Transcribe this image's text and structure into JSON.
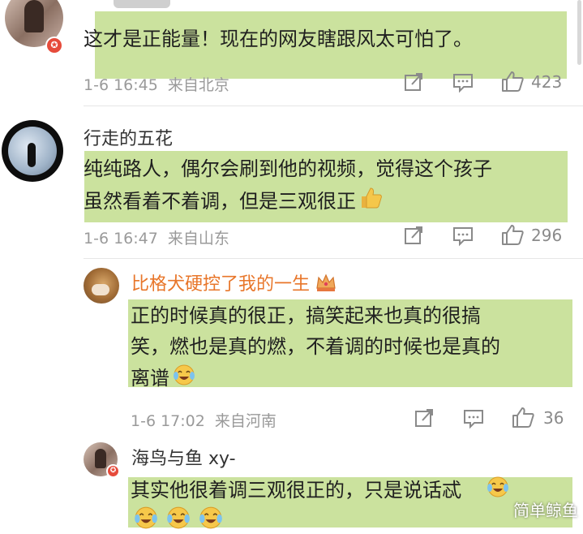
{
  "comments": [
    {
      "username": "",
      "text_lines": [
        "这才是正能量！现在的网友瞎跟风太可怕了。"
      ],
      "time": "1-6 16:45",
      "location": "来自北京",
      "likes": "423"
    },
    {
      "username": "行走的五花",
      "text_lines": [
        "纯纯路人，偶尔会刷到他的视频，觉得这个孩子",
        "虽然看着不着调，但是三观很正"
      ],
      "time": "1-6 16:47",
      "location": "来自山东",
      "likes": "296"
    },
    {
      "username": "比格犬硬控了我的一生",
      "text_lines": [
        "正的时候真的很正，搞笑起来也真的很搞",
        "笑，燃也是真的燃，不着调的时候也是真的",
        "离谱"
      ],
      "time": "1-6 17:02",
      "location": "来自河南",
      "likes": "36"
    },
    {
      "username": "海鸟与鱼 xy-",
      "text_lines": [
        "其实他很着调三观很正的，只是说话忒"
      ],
      "time": "",
      "location": "",
      "likes": ""
    }
  ],
  "badge_symbol": "✪",
  "watermark": "简单鲸鱼",
  "colors": {
    "highlight": "#c2dd8d",
    "vip_name": "#e8762a",
    "badge": "#e64b3b"
  },
  "icons": [
    "share-icon",
    "comment-icon",
    "like-icon",
    "thumbs-up-emoji",
    "laughing-crying-emoji",
    "crown-emoji"
  ]
}
